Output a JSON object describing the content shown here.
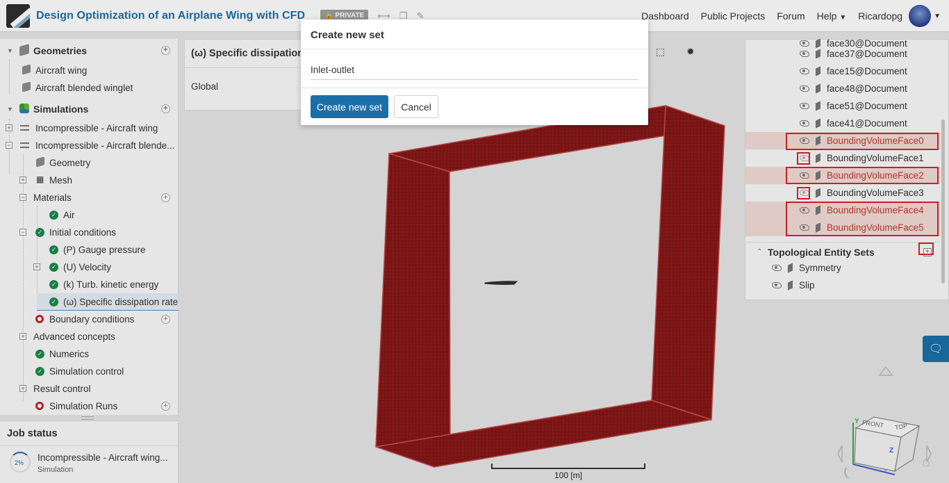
{
  "header": {
    "title": "Design Optimization of an Airplane Wing with CFD",
    "private_badge": "PRIVATE",
    "nav": [
      "Dashboard",
      "Public Projects",
      "Forum",
      "Help"
    ],
    "username": "Ricardopg"
  },
  "tree": {
    "geometries_label": "Geometries",
    "geometries": [
      "Aircraft wing",
      "Aircraft blended winglet"
    ],
    "simulations_label": "Simulations",
    "sim1": "Incompressible - Aircraft wing",
    "sim2": "Incompressible - Aircraft blende...",
    "geometry": "Geometry",
    "mesh": "Mesh",
    "materials": "Materials",
    "air": "Air",
    "initial_conditions": "Initial conditions",
    "gauge_pressure": "(P) Gauge pressure",
    "velocity": "(U) Velocity",
    "tke": "(k) Turb. kinetic energy",
    "sdr": "(ω) Specific dissipation rate",
    "boundary_conditions": "Boundary conditions",
    "advanced_concepts": "Advanced concepts",
    "numerics": "Numerics",
    "simulation_control": "Simulation control",
    "result_control": "Result control",
    "simulation_runs": "Simulation Runs"
  },
  "job": {
    "title": "Job status",
    "progress": "2%",
    "name": "Incompressible - Aircraft wing...",
    "type": "Simulation"
  },
  "property": {
    "title": "(ω) Specific dissipation r",
    "global": "Global"
  },
  "faces": {
    "partial_top": "face30@Document",
    "items": [
      "face37@Document",
      "face15@Document",
      "face48@Document",
      "face51@Document",
      "face41@Document",
      "BoundingVolumeFace0",
      "BoundingVolumeFace1",
      "BoundingVolumeFace2",
      "BoundingVolumeFace3",
      "BoundingVolumeFace4",
      "BoundingVolumeFace5"
    ]
  },
  "topo_sets": {
    "title": "Topological Entity Sets",
    "items": [
      "Symmetry",
      "Slip"
    ]
  },
  "viewer": {
    "scale_label": "100 [m]",
    "cube_front": "FRONT",
    "cube_top": "TOP",
    "axis_y": "Y",
    "axis_z": "Z",
    "mesh_color": "#8b1a1a"
  },
  "modal": {
    "title": "Create new set",
    "input_value": "Inlet-outlet",
    "create_button": "Create new set",
    "cancel_button": "Cancel"
  },
  "colors": {
    "accent": "#1b6fa8",
    "highlight": "#c0392b",
    "ok": "#1d8a4c",
    "error": "#c0272d"
  }
}
